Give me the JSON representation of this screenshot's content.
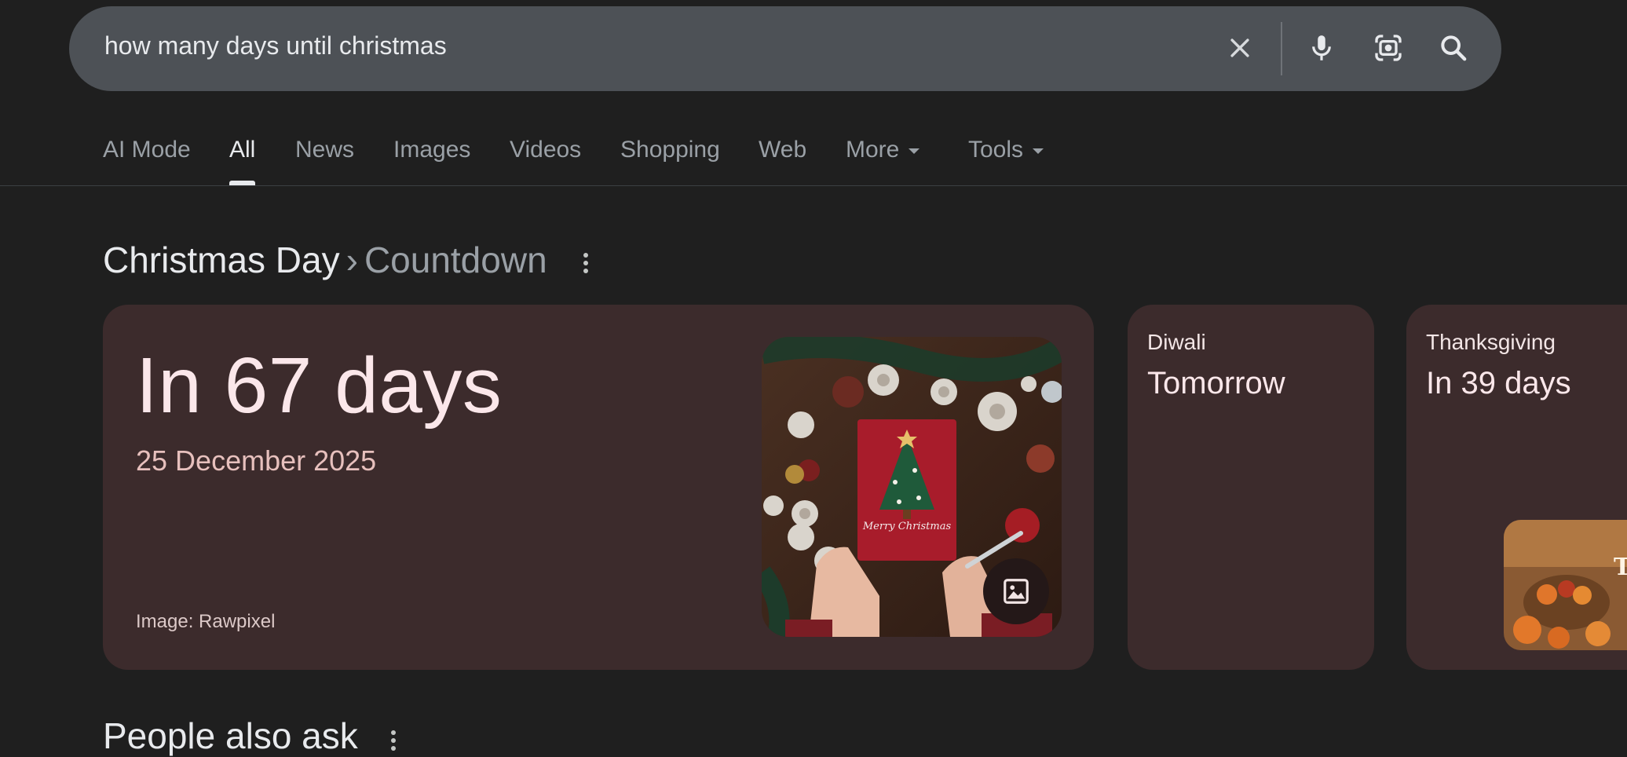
{
  "search": {
    "query": "how many days until christmas",
    "icons": [
      "close-icon",
      "microphone-icon",
      "lens-camera-icon",
      "search-icon"
    ]
  },
  "tabs": [
    {
      "label": "AI Mode"
    },
    {
      "label": "All",
      "active": true
    },
    {
      "label": "News"
    },
    {
      "label": "Images"
    },
    {
      "label": "Videos"
    },
    {
      "label": "Shopping"
    },
    {
      "label": "Web"
    },
    {
      "label": "More"
    },
    {
      "label": "Tools"
    }
  ],
  "result": {
    "heading": "Christmas Day",
    "separator": "›",
    "subheading": "Countdown",
    "main_card": {
      "countdown": "In 67 days",
      "date": "25 December 2025",
      "image_credit": "Image: Rawpixel",
      "image_subject": "Christmas card with tree illustration and pinecones",
      "card_text": "Merry Christmas"
    },
    "side_cards": [
      {
        "label": "Diwali",
        "value": "Tomorrow"
      },
      {
        "label": "Thanksgiving",
        "value": "In 39 days",
        "thumb_text": "Th"
      }
    ]
  },
  "people_also_ask": {
    "title": "People also ask"
  },
  "colors": {
    "background": "#1f1f1f",
    "searchbar": "#4d5156",
    "card": "#3c2b2c",
    "text_primary": "#e8eaed",
    "text_muted": "#9aa0a6"
  }
}
